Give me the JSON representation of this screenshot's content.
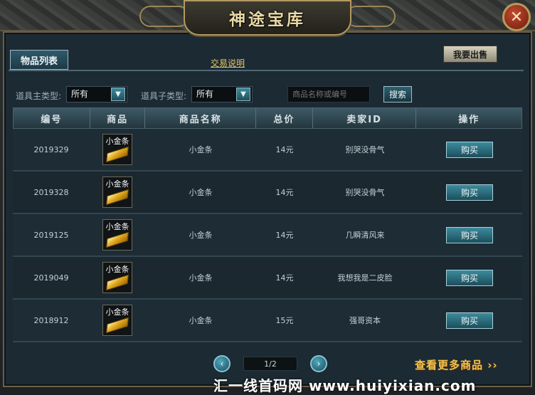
{
  "window": {
    "title": "神途宝库",
    "close_glyph": "✕"
  },
  "tabs": {
    "item_list": "物品列表"
  },
  "links": {
    "trade_help": "交易说明",
    "more_items": "查看更多商品 ››"
  },
  "buttons": {
    "sell": "我要出售",
    "search": "搜索",
    "buy": "购买"
  },
  "filters": {
    "main_type_label": "道具主类型:",
    "main_type_value": "所有",
    "sub_type_label": "道具子类型:",
    "sub_type_value": "所有",
    "search_placeholder": "商品名称或编号"
  },
  "table": {
    "headers": [
      "编号",
      "商品",
      "商品名称",
      "总价",
      "卖家ID",
      "操作"
    ],
    "rows": [
      {
        "id": "2019329",
        "icon_label": "小金条",
        "name": "小金条",
        "price": "14元",
        "seller": "别哭没骨气"
      },
      {
        "id": "2019328",
        "icon_label": "小金条",
        "name": "小金条",
        "price": "14元",
        "seller": "别哭没骨气"
      },
      {
        "id": "2019125",
        "icon_label": "小金条",
        "name": "小金条",
        "price": "14元",
        "seller": "几瞬清风来"
      },
      {
        "id": "2019049",
        "icon_label": "小金条",
        "name": "小金条",
        "price": "14元",
        "seller": "我想我是二皮脸"
      },
      {
        "id": "2018912",
        "icon_label": "小金条",
        "name": "小金条",
        "price": "15元",
        "seller": "强哥资本"
      }
    ]
  },
  "pagination": {
    "current": "1/2",
    "prev_glyph": "‹",
    "next_glyph": "›"
  },
  "watermark": "汇一线首码网 www.huiyixian.com",
  "colors": {
    "accent_gold": "#e4c56a",
    "buy_button": "#2a6b7a",
    "panel": "#1c2a33"
  }
}
